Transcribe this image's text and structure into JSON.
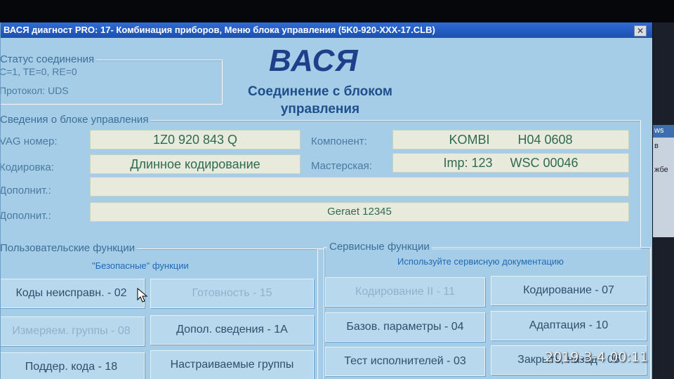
{
  "window": {
    "title": "ВАСЯ диагност PRO: 17- Комбинация приборов,  Меню блока управления (5K0-920-XXX-17.CLB)",
    "close_glyph": "✕"
  },
  "background_window": {
    "lines": [
      "ws",
      "в",
      "жбе"
    ]
  },
  "connection_status": {
    "group_label": "Статус соединения",
    "line1": "C=1, TE=0,  RE=0",
    "line2": "Протокол: UDS"
  },
  "header": {
    "logo": "ВАСЯ",
    "connection_text": "Соединение с блоком управления"
  },
  "unit_info": {
    "group_label": "Сведения о блоке управления",
    "vag_label": "VAG номер:",
    "vag_value": "1Z0 920 843 Q",
    "component_label": "Компонент:",
    "component_value": "KOMBI        H04 0608",
    "coding_label": "Кодировка:",
    "coding_value": "Длинное кодирование",
    "workshop_label": "Мастерская:",
    "workshop_value": "Imp: 123     WSC 00046",
    "extra1_label": "Дополнит.:",
    "extra1_value": "",
    "extra2_label": "Дополнит.:",
    "extra2_value": "Geraet 12345"
  },
  "user_functions": {
    "group_label": "Пользовательские функции",
    "subtitle": "\"Безопасные\" функции",
    "buttons": {
      "fault_codes": "Коды неисправн. - 02",
      "readiness": "Готовность - 15",
      "measuring_groups": "Измеряем. группы - 08",
      "extra_info": "Допол. сведения - 1A",
      "supported_codes": "Поддер. кода - 18",
      "custom_groups": "Настраиваемые группы"
    }
  },
  "service_functions": {
    "group_label": "Сервисные функции",
    "subtitle": "Используйте сервисную документацию",
    "buttons": {
      "coding2": "Кодирование II - 11",
      "coding": "Кодирование - 07",
      "basic_settings": "Базов. параметры - 04",
      "adaptation": "Адаптация - 10",
      "output_test": "Тест исполнителей - 03",
      "close_controller": "Закрыть, назад - 06"
    }
  },
  "photo_timestamp": "2019-3-4  00:11"
}
